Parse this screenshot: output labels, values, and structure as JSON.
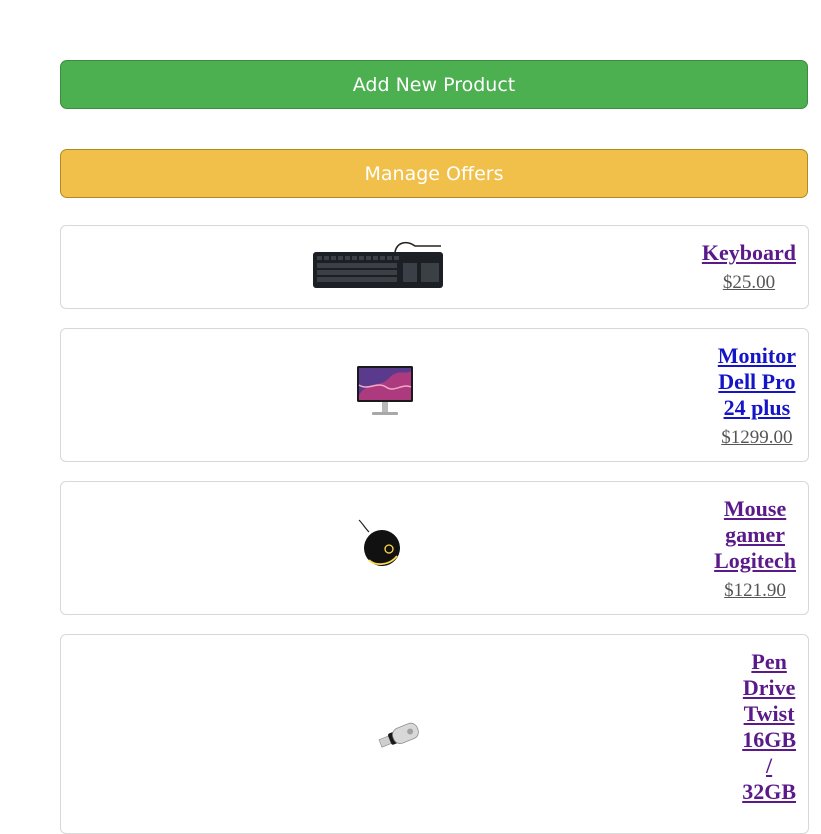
{
  "buttons": {
    "add_product": "Add New Product",
    "manage_offers": "Manage Offers"
  },
  "products": [
    {
      "name_lines": [
        "Keyboard"
      ],
      "price": "$25.00",
      "image": "keyboard-image"
    },
    {
      "name_lines": [
        "Monitor",
        "Dell Pro",
        "24 plus"
      ],
      "price": "$1299.00",
      "image": "monitor-image"
    },
    {
      "name_lines": [
        "Mouse",
        "gamer",
        "Logitech"
      ],
      "price": "$121.90",
      "image": "mouse-image"
    },
    {
      "name_lines": [
        "Pen",
        "Drive",
        "Twist",
        "16GB",
        "/",
        "32GB"
      ],
      "price": "",
      "image": "pen-drive-image"
    }
  ],
  "colors": {
    "add_button": "#4caf50",
    "offers_button": "#f0c04a",
    "product_link": "#5b1a8a",
    "product_link_unvisited": "#1414c8"
  }
}
